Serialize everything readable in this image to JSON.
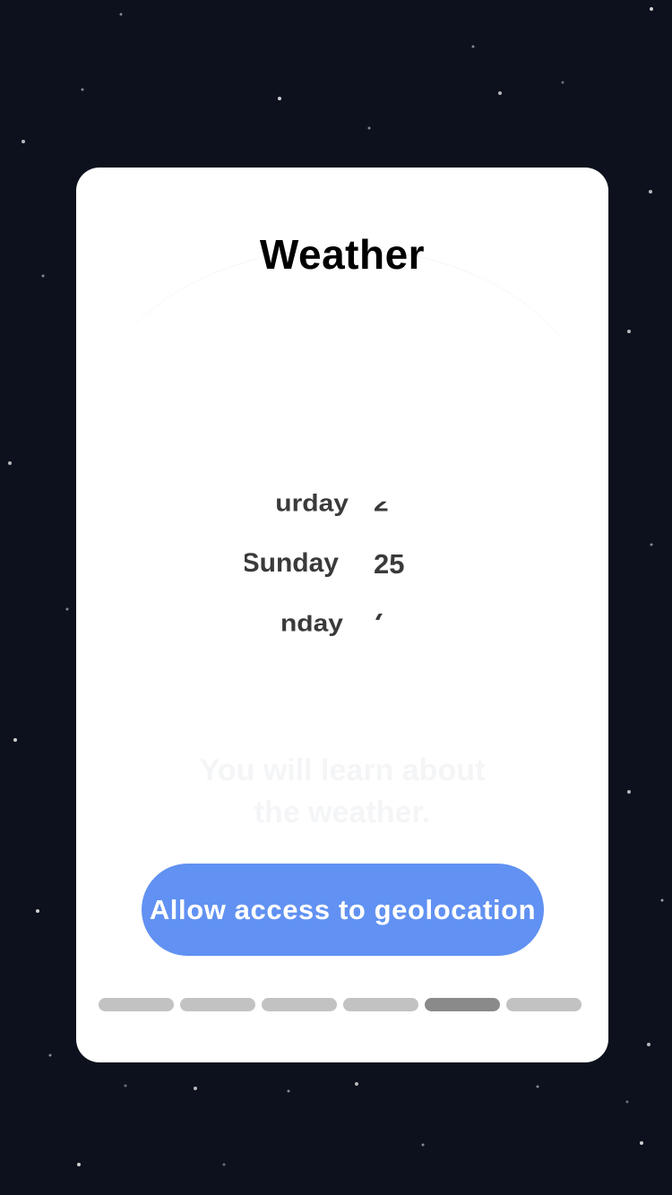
{
  "colors": {
    "background": "#0c111d",
    "card": "#ffffff",
    "accent": "#6191f2",
    "dot_inactive": "#c2c2c2",
    "dot_active": "#8a8a8a"
  },
  "card": {
    "title": "Weather",
    "subtitle_line1": "You will learn about",
    "subtitle_line2": "the weather."
  },
  "picker": {
    "rows": [
      {
        "day": "urday",
        "num": "2"
      },
      {
        "day": "Sunday",
        "num": "25"
      },
      {
        "day": "nday",
        "num": "("
      }
    ]
  },
  "cta": {
    "label": "Allow access to geolocation"
  },
  "pagination": {
    "total": 6,
    "active_index": 4
  }
}
